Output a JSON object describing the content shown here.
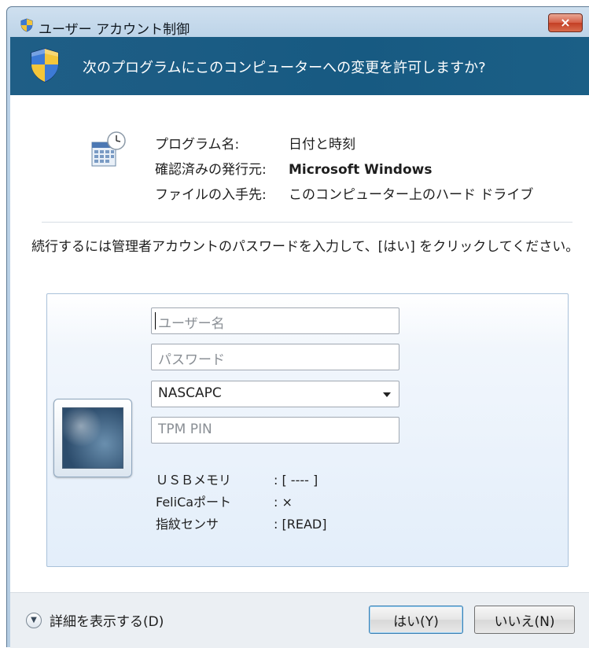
{
  "window": {
    "title": "ユーザー アカウント制御",
    "close_label": "×"
  },
  "banner": {
    "question": "次のプログラムにこのコンピューターへの変更を許可しますか?"
  },
  "program": {
    "name_label": "プログラム名:",
    "name_value": "日付と時刻",
    "publisher_label": "確認済みの発行元:",
    "publisher_value": "Microsoft Windows",
    "origin_label": "ファイルの入手先:",
    "origin_value": "このコンピューター上のハード ドライブ",
    "icon": "date-time-icon"
  },
  "instruction": "続行するには管理者アカウントのパスワードを入力して、[はい] をクリックしてください。",
  "credentials": {
    "username_placeholder": "ユーザー名",
    "password_placeholder": "パスワード",
    "domain_value": "NASCAPC",
    "pin_placeholder": "TPM PIN",
    "devices": [
      {
        "label": "ＵＳＢメモリ",
        "value": ": [  ----  ]"
      },
      {
        "label": "FeliCaポート",
        "value": ":     ×"
      },
      {
        "label": "指紋センサ",
        "value": ": [READ]"
      }
    ]
  },
  "footer": {
    "details_label": "詳細を表示する(D)",
    "yes_label": "はい(Y)",
    "no_label": "いいえ(N)"
  },
  "colors": {
    "banner": "#1c5c85",
    "footer": "#ebeff3",
    "close_button": "#d55e46"
  }
}
